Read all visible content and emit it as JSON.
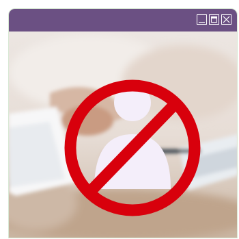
{
  "window": {
    "titlebar_color": "#6b5083",
    "controls": [
      "minimize-icon",
      "maximize-icon",
      "close-icon"
    ]
  },
  "content": {
    "background_photo": "blurred-desk-hands-paperwork",
    "overlay_icon": "no-user-icon",
    "overlay_color": "#d8000c",
    "silhouette_color": "#f4eefa"
  }
}
